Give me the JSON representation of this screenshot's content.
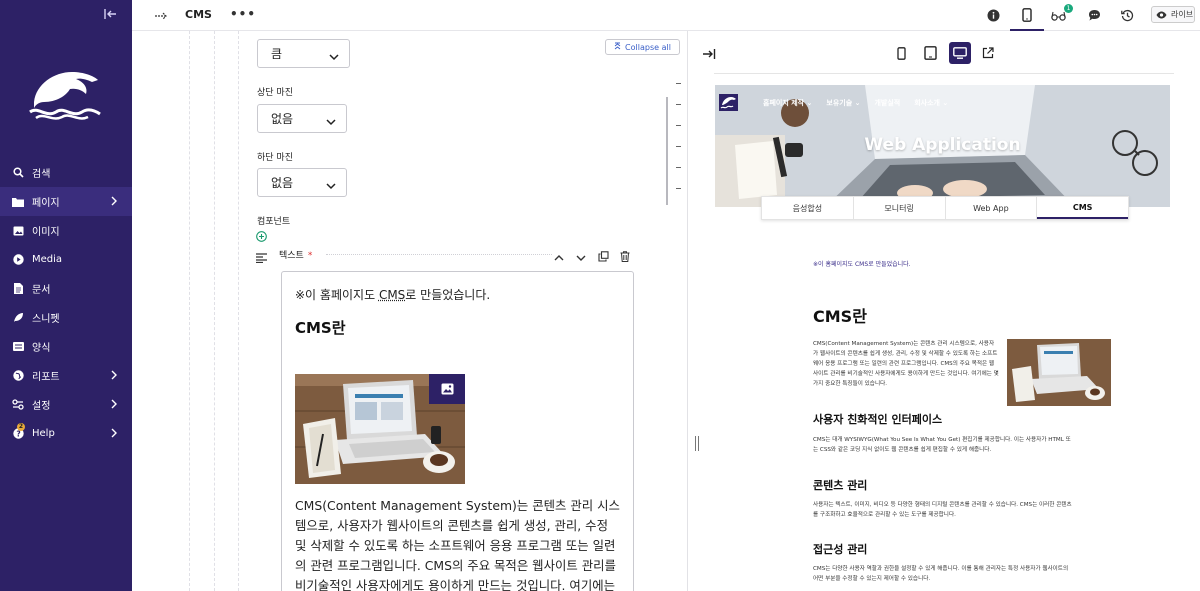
{
  "sidebar": {
    "items": [
      {
        "label": "검색",
        "icon": "search-icon"
      },
      {
        "label": "페이지",
        "icon": "folder-icon",
        "has_submenu": true,
        "active": true
      },
      {
        "label": "이미지",
        "icon": "image-icon"
      },
      {
        "label": "Media",
        "icon": "play-icon"
      },
      {
        "label": "문서",
        "icon": "document-icon"
      },
      {
        "label": "스니펫",
        "icon": "leaf-icon"
      },
      {
        "label": "양식",
        "icon": "form-icon"
      },
      {
        "label": "리포트",
        "icon": "globe-icon",
        "has_submenu": true
      },
      {
        "label": "설정",
        "icon": "settings-icon",
        "has_submenu": true
      },
      {
        "label": "Help",
        "icon": "help-icon",
        "has_submenu": true,
        "badge": "2"
      }
    ],
    "bg_color": "#2d2166"
  },
  "topbar": {
    "title": "CMS",
    "more": "•••",
    "notif_badge": "1",
    "live_label": "라이브"
  },
  "editor": {
    "size_select": "큼",
    "top_margin_label": "상단 마진",
    "top_margin_value": "없음",
    "bottom_margin_label": "하단 마진",
    "bottom_margin_value": "없음",
    "collapse_all": "Collapse all",
    "components_label": "컴포넌트",
    "component_name": "텍스트",
    "required_mark": "*",
    "text": {
      "note_prefix": "※이 홈페이지도 ",
      "note_link": "CMS",
      "note_suffix": "로 만들었습니다.",
      "heading": "CMS란",
      "body": "CMS(Content Management System)는 콘텐츠 관리 시스템으로, 사용자가 웹사이트의 콘텐츠를 쉽게 생성, 관리, 수정 및 삭제할 수 있도록 하는 소프트웨어 응용 프로그램 또는 일련의 관련 프로그램입니다. CMS의 주요 목적은 웹사이트 관리를 비기술적인 사용자에게도 용이하게 만드는 것입니다. 여기에는 몇 가지 중요한 특징"
    }
  },
  "preview": {
    "nav": [
      "홈페이지 제작 ⌄",
      "보유기술 ⌄",
      "개발실적",
      "회사소개 ⌄"
    ],
    "hero_title": "Web Application",
    "tabs": [
      "음성합성",
      "모니터링",
      "Web App",
      "CMS"
    ],
    "active_tab": "CMS",
    "note": "※이 홈페이지도 CMS로 만들었습니다.",
    "h1": "CMS란",
    "intro": "CMS(Content Management System)는 콘텐츠 관리 시스템으로, 사용자가 웹사이트의 콘텐츠를 쉽게 생성, 관리, 수정 및 삭제할 수 있도록 하는 소프트웨어 응용 프로그램 또는 일련의 관련 프로그램입니다. CMS의 주요 목적은 웹사이트 관리를 비기술적인 사용자에게도 용이하게 만드는 것입니다. 여기에는 몇 가지 중요한 특징들이 있습니다.",
    "sections": [
      {
        "title": "사용자 친화적인 인터페이스",
        "body": "CMS는 대개 WYSIWYG(What You See Is What You Get) 편집기를 제공합니다. 이는 사용자가 HTML 또는 CSS와 같은 코딩 지식 없이도 웹 콘텐츠를 쉽게 편집할 수 있게 해줍니다."
      },
      {
        "title": "콘텐츠 관리",
        "body": "사용자는 텍스트, 이미지, 비디오 등 다양한 형태의 디지털 콘텐츠를 관리할 수 있습니다. CMS는 이러한 콘텐츠를 구조화하고 효율적으로 관리할 수 있는 도구를 제공합니다."
      },
      {
        "title": "접근성 관리",
        "body": "CMS는 다양한 사용자 역할과 권한을 설정할 수 있게 해줍니다. 이를 통해 관리자는 특정 사용자가 웹사이트의 어떤 부분을 수정할 수 있는지 제어할 수 있습니다."
      }
    ]
  },
  "colors": {
    "accent": "#2d2166",
    "link": "#3a5fc8",
    "badge_green": "#1aa97d",
    "badge_orange": "#e8a93a"
  }
}
